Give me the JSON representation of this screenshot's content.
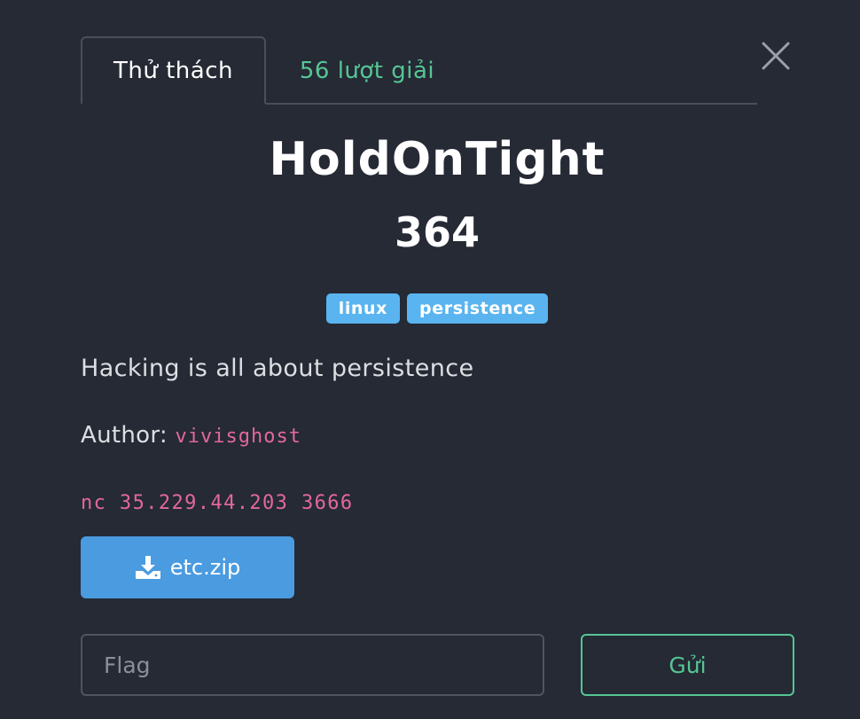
{
  "tabs": {
    "challenge_label": "Thử thách",
    "solves_label": "56 lượt giải"
  },
  "close": {
    "icon": "close-icon"
  },
  "challenge": {
    "name": "HoldOnTight",
    "points": "364",
    "tags": [
      "linux",
      "persistence"
    ],
    "description": "Hacking is all about persistence",
    "author_label": "Author:",
    "author_name": "vivisghost",
    "connection": "nc 35.229.44.203 3666"
  },
  "download": {
    "icon": "download-icon",
    "file_name": "etc.zip"
  },
  "flag_form": {
    "placeholder": "Flag",
    "submit_label": "Gửi"
  },
  "colors": {
    "background": "#252a35",
    "accent_green": "#56c593",
    "tag_blue": "#5ab4f0",
    "button_blue": "#4a9be0",
    "code_pink": "#e3679d"
  }
}
